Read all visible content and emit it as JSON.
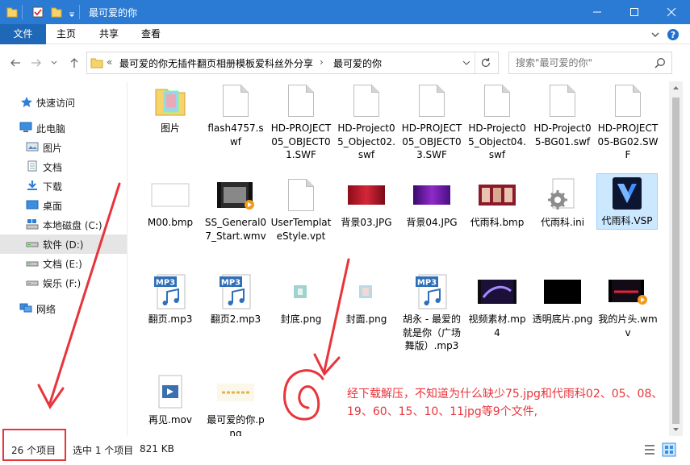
{
  "window": {
    "title": "最可爱的你",
    "controls": {
      "minimize": "—",
      "maximize": "☐",
      "close": "✕"
    }
  },
  "ribbon": {
    "tabs": [
      "文件",
      "主页",
      "共享",
      "查看"
    ],
    "expand_icon": "chevron-down-icon",
    "help_icon": "help-icon"
  },
  "address": {
    "overflow": "«",
    "segments": [
      "最可爱的你无插件翻页相册模板爱科丝外分享",
      "最可爱的你"
    ],
    "separator": "›"
  },
  "search": {
    "placeholder": "搜索\"最可爱的你\""
  },
  "nav": {
    "quick_access": "快速访问",
    "this_pc": "此电脑",
    "pc_items": [
      "图片",
      "文档",
      "下载",
      "桌面",
      "本地磁盘 (C:)",
      "软件 (D:)",
      "文档 (E:)",
      "娱乐 (F:)"
    ],
    "network": "网络",
    "selected": "软件 (D:)"
  },
  "files": [
    {
      "name": "图片",
      "icon": "folder-icon"
    },
    {
      "name": "flash4757.swf",
      "icon": "document-icon"
    },
    {
      "name": "HD-PROJECT05_OBJECT01.SWF",
      "icon": "document-icon"
    },
    {
      "name": "HD-Project05_Object02.swf",
      "icon": "document-icon"
    },
    {
      "name": "HD-PROJECT05_OBJECT03.SWF",
      "icon": "document-icon"
    },
    {
      "name": "HD-Project05_Object04.swf",
      "icon": "document-icon"
    },
    {
      "name": "HD-Project05-BG01.swf",
      "icon": "document-icon"
    },
    {
      "name": "HD-PROJECT05-BG02.SWF",
      "icon": "document-icon"
    },
    {
      "name": "M00.bmp",
      "icon": "bmp-thumbnail"
    },
    {
      "name": "SS_General07_Start.wmv",
      "icon": "video-thumbnail"
    },
    {
      "name": "UserTemplateStyle.vpt",
      "icon": "document-icon"
    },
    {
      "name": "背景03.JPG",
      "icon": "red-image-thumbnail"
    },
    {
      "name": "背景04.JPG",
      "icon": "purple-image-thumbnail"
    },
    {
      "name": "代雨科.bmp",
      "icon": "photo-thumbnail"
    },
    {
      "name": "代雨科.ini",
      "icon": "gear-document-icon"
    },
    {
      "name": "代雨科.VSP",
      "icon": "vsp-logo-icon"
    },
    {
      "name": "翻页.mp3",
      "icon": "mp3-icon"
    },
    {
      "name": "翻页2.mp3",
      "icon": "mp3-icon"
    },
    {
      "name": "封底.png",
      "icon": "small-image-thumbnail"
    },
    {
      "name": "封面.png",
      "icon": "small-image-thumbnail"
    },
    {
      "name": "胡永 - 最爱的就是你（广场舞版）.mp3",
      "icon": "mp3-icon"
    },
    {
      "name": "视频素材.mp4",
      "icon": "video-thumbnail"
    },
    {
      "name": "透明底片.png",
      "icon": "black-image-thumbnail"
    },
    {
      "name": "我的片头.wmv",
      "icon": "video-thumbnail"
    },
    {
      "name": "再见.mov",
      "icon": "media-document-icon"
    },
    {
      "name": "最可爱的你.png",
      "icon": "text-image-thumbnail"
    }
  ],
  "selected_file": "代雨科.VSP",
  "mp3_label": "MP3",
  "status": {
    "count": "26 个项目",
    "selection": "选中 1 个项目",
    "size": "821 KB"
  },
  "annotation": {
    "text": "经下载解压，不知道为什么缺少75.jpg和代雨科02、05、08、19、60、15、10、11jpg等9个文件,",
    "color": "#e8343b"
  },
  "colors": {
    "title_bar": "#2b7bd4",
    "file_tab": "#1f68b8",
    "selection": "#cce8ff"
  }
}
